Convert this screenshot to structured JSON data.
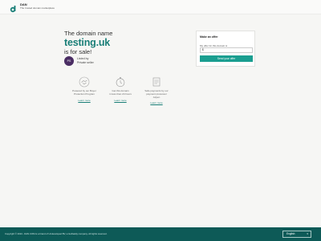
{
  "brand": {
    "name": "DAN",
    "tagline": "The trusted domain marketplace",
    "icon": "dan-logo-icon",
    "color": "#1a7f78"
  },
  "hero": {
    "line1": "The domain name",
    "domain": "testing.uk",
    "line3": "is for sale!"
  },
  "seller": {
    "avatar_initials": "PS",
    "line1": "Listed by",
    "line2": "Private seller"
  },
  "features": [
    {
      "icon": "handshake-icon",
      "desc_line1": "Powered by our Buyer",
      "desc_line2": "Protection Program",
      "link": "Learn more"
    },
    {
      "icon": "stopwatch-icon",
      "desc_line1": "Get this domain",
      "desc_line2": "in less than 24 hours",
      "link": "Learn more"
    },
    {
      "icon": "receipt-icon",
      "desc_line1": "Safe payments by our",
      "desc_line2": "payment processor Adyen",
      "link": "Learn more"
    }
  ],
  "offer": {
    "title": "Make an offer",
    "label": "My offer for this domain is",
    "currency": "$",
    "button": "Send your offer"
  },
  "footer": {
    "copyright": "Copyright © 2024 - DAN.COM is a brand of Undeveloped BV, a GoDaddy company. All rights reserved.",
    "language": "English",
    "caret": "▾"
  },
  "colors": {
    "accent": "#1a7f78",
    "button": "#1a9e90",
    "footer_bg": "#0d5a57",
    "avatar_bg": "#4a2d63"
  }
}
